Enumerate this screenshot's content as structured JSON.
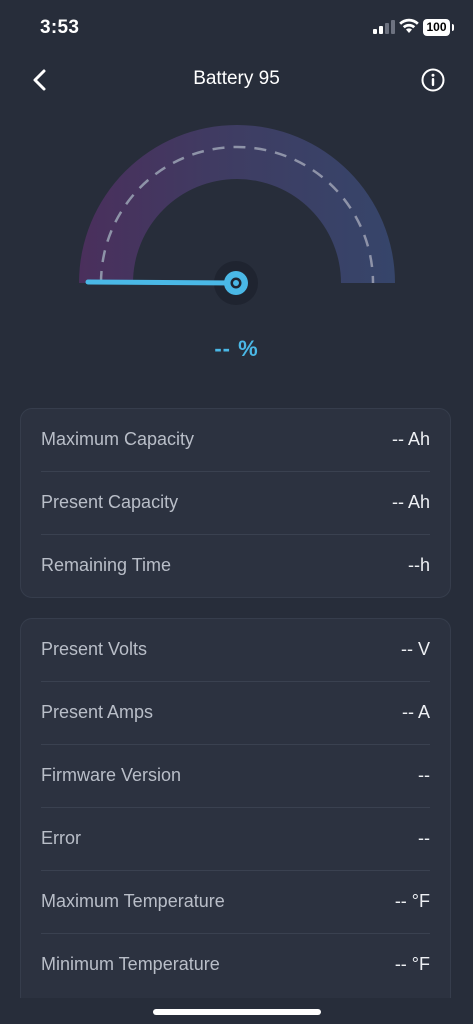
{
  "status_bar": {
    "time": "3:53",
    "battery_level": "100"
  },
  "header": {
    "title": "Battery 95",
    "back_icon": "chevron-left-icon",
    "info_icon": "info-circle-icon"
  },
  "gauge": {
    "readout": "-- %",
    "level": 0,
    "accent_color": "#4ab8e6"
  },
  "capacity_card": {
    "rows": [
      {
        "label": "Maximum Capacity",
        "value": "-- Ah"
      },
      {
        "label": "Present Capacity",
        "value": "-- Ah"
      },
      {
        "label": "Remaining Time",
        "value": "--h"
      }
    ]
  },
  "details_card": {
    "rows": [
      {
        "label": "Present Volts",
        "value": "-- V"
      },
      {
        "label": "Present Amps",
        "value": "-- A"
      },
      {
        "label": "Firmware Version",
        "value": "--"
      },
      {
        "label": "Error",
        "value": "--"
      },
      {
        "label": "Maximum Temperature",
        "value": "-- °F"
      },
      {
        "label": "Minimum Temperature",
        "value": "-- °F"
      }
    ]
  }
}
